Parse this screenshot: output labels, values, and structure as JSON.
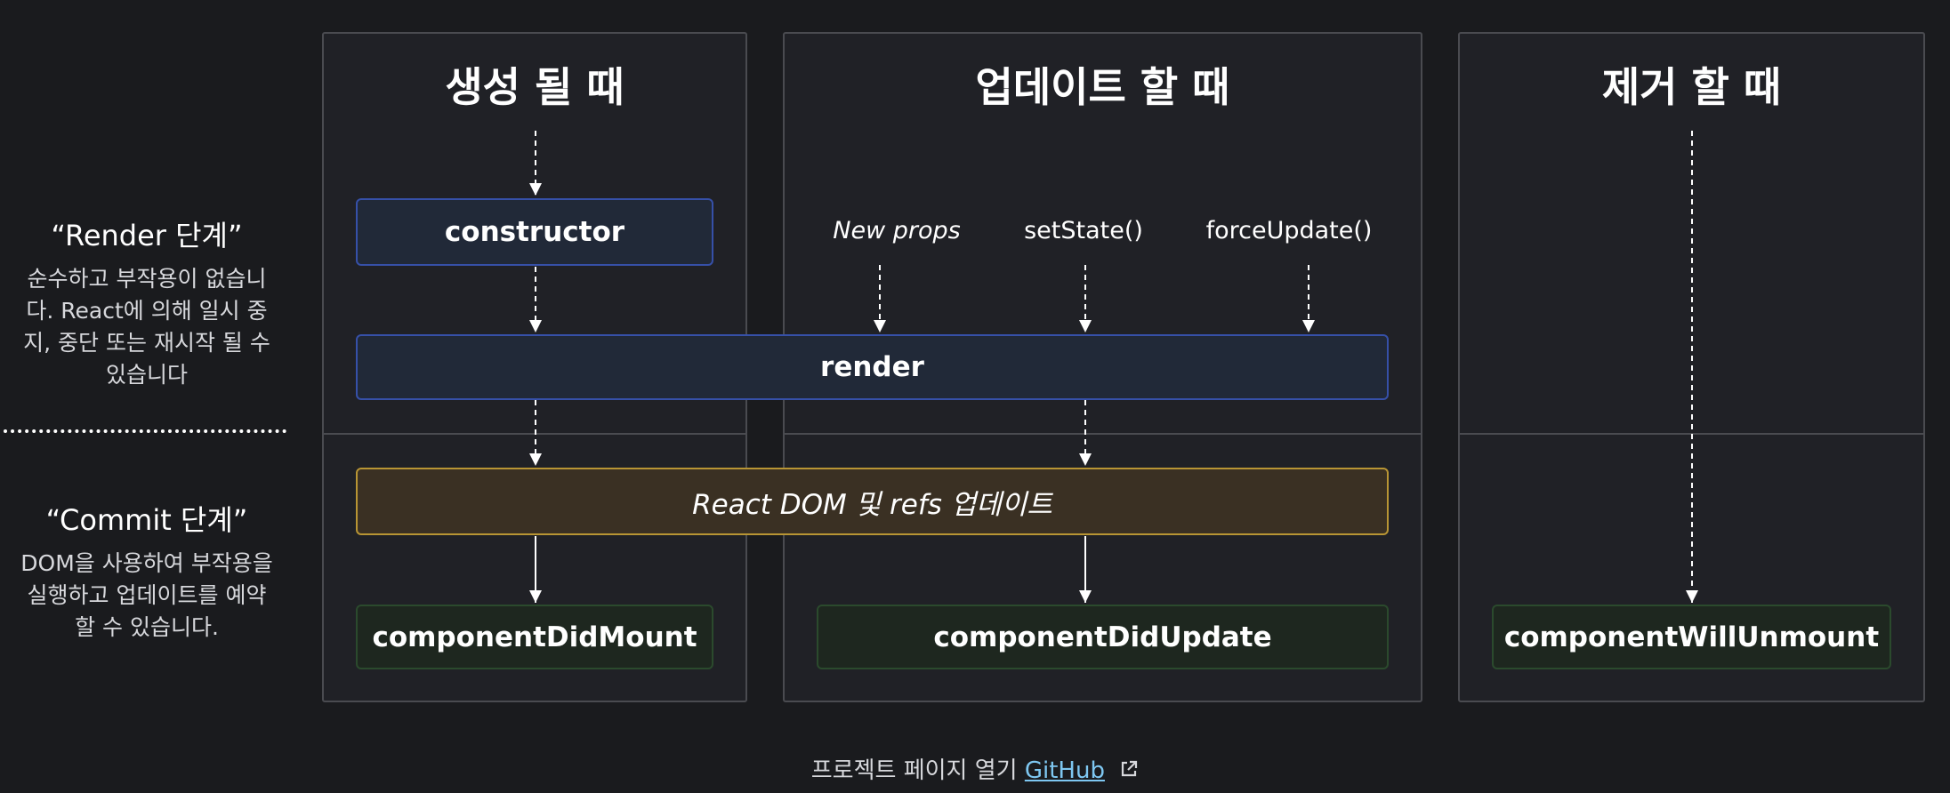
{
  "columns": {
    "mount_title": "생성 될 때",
    "update_title": "업데이트 할 때",
    "unmount_title": "제거 할 때"
  },
  "phases": {
    "render_title": "“Render 단계”",
    "render_desc": "순수하고 부작용이 없습니다. React에 의해 일시 중지, 중단 또는 재시작 될 수 있습니다",
    "commit_title": "“Commit 단계”",
    "commit_desc": "DOM을 사용하여 부작용을 실행하고 업데이트를 예약 할 수 있습니다."
  },
  "triggers": {
    "new_props": "New props",
    "set_state": "setState()",
    "force_update": "forceUpdate()"
  },
  "methods": {
    "constructor": "constructor",
    "render": "render",
    "dom_update": "React DOM 및 refs 업데이트",
    "did_mount": "componentDidMount",
    "did_update": "componentDidUpdate",
    "will_unmount": "componentWillUnmount"
  },
  "footer": {
    "prefix": "프로젝트 페이지 열기",
    "link": "GitHub",
    "icon": "external-link-icon"
  },
  "colors": {
    "background": "#1a1b1e",
    "render_box_border": "#3650a8",
    "commit_box_border": "#b89534",
    "lifecycle_box_border": "#2b4a2d",
    "link": "#7ec7f1"
  }
}
